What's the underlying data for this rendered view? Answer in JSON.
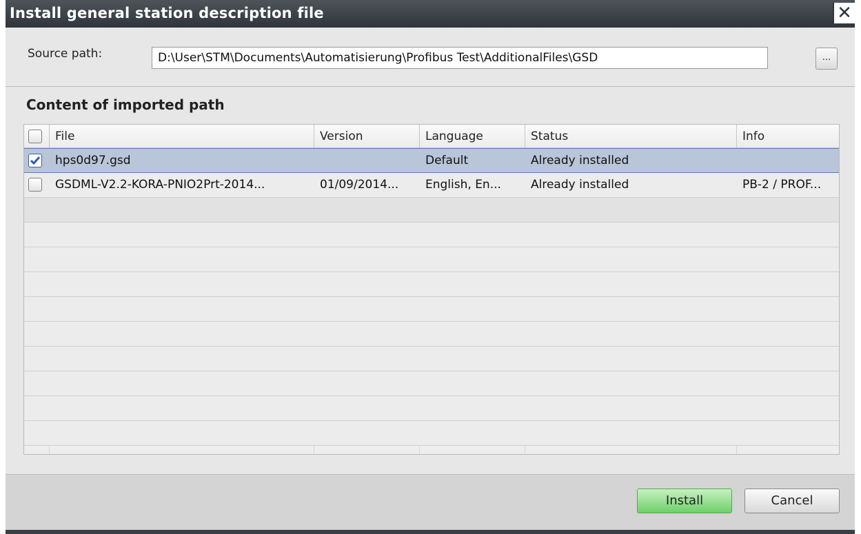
{
  "window": {
    "title": "Install general station description file",
    "close_label": "✕"
  },
  "source": {
    "label": "Source path:",
    "value": "D:\\User\\STM\\Documents\\Automatisierung\\Profibus Test\\AdditionalFiles\\GSD",
    "browse_label": "..."
  },
  "section": {
    "title": "Content of imported path"
  },
  "table": {
    "headers": [
      "File",
      "Version",
      "Language",
      "Status",
      "Info"
    ],
    "rows": [
      {
        "checked": true,
        "file": "hps0d97.gsd",
        "version": "",
        "language": "Default",
        "status": "Already installed",
        "info": ""
      },
      {
        "checked": false,
        "file": "GSDML-V2.2-KORA-PNIO2Prt-2014...",
        "version": "01/09/2014...",
        "language": "English, En...",
        "status": "Already installed",
        "info": "PB-2 / PROF..."
      }
    ]
  },
  "buttons": {
    "install": "Install",
    "cancel": "Cancel"
  },
  "colors": {
    "titlebar": "#3c4349",
    "selection": "#b9c5d9",
    "install_green": "#6fcf6a"
  }
}
